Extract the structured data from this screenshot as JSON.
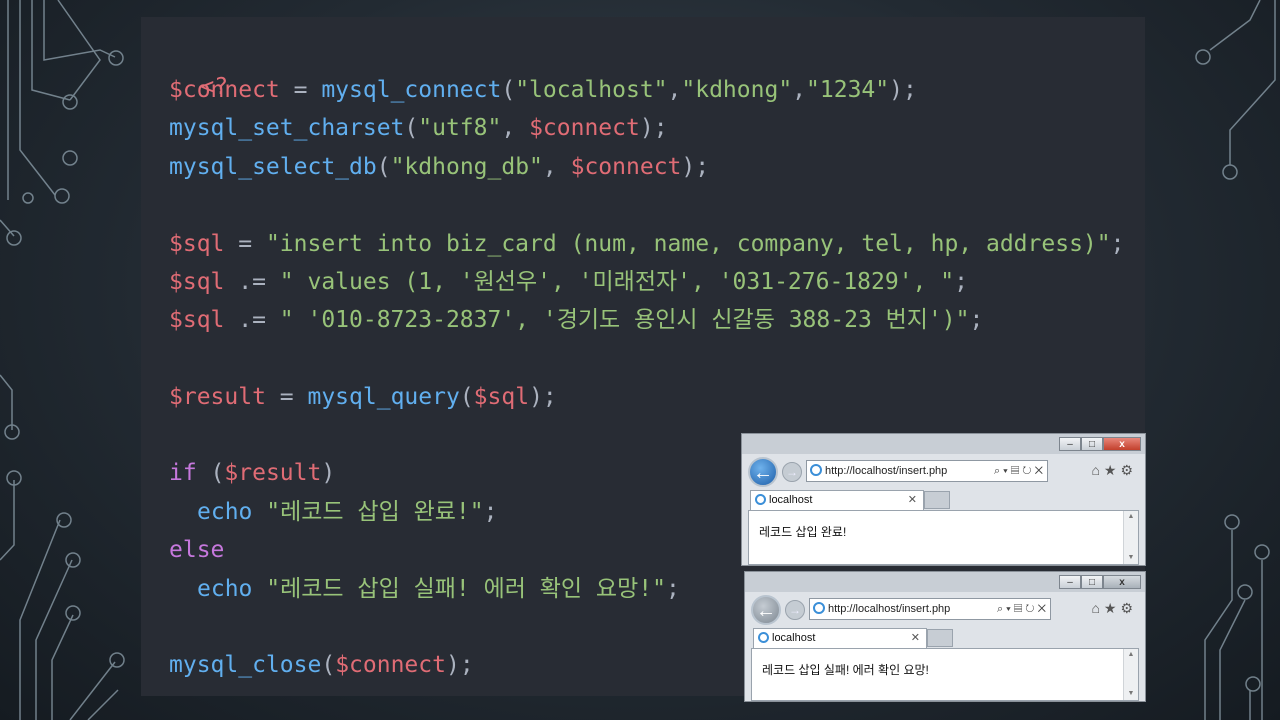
{
  "code": {
    "open_tag": "<?",
    "close_tag": "?>",
    "l1": {
      "var": "$connect",
      "op": " = ",
      "fn": "mysql_connect",
      "p1": "(",
      "s1": "\"localhost\"",
      "c1": ",",
      "s2": "\"kdhong\"",
      "c2": ",",
      "s3": "\"1234\"",
      "end": ");"
    },
    "l2": {
      "fn": "mysql_set_charset",
      "p1": "(",
      "s1": "\"utf8\"",
      "c1": ", ",
      "var": "$connect",
      "end": ");"
    },
    "l3": {
      "fn": "mysql_select_db",
      "p1": "(",
      "s1": "\"kdhong_db\"",
      "c1": ", ",
      "var": "$connect",
      "end": ");"
    },
    "l4": {
      "var": "$sql",
      "op": " = ",
      "str": "\"insert into biz_card (num, name, company, tel, hp, address)\"",
      "end": ";"
    },
    "l5": {
      "var": "$sql",
      "op": " .= ",
      "str": "\" values (1, '원선우', '미래전자', '031-276-1829', \"",
      "end": ";"
    },
    "l6": {
      "var": "$sql",
      "op": " .= ",
      "str": "\" '010-8723-2837', '경기도 용인시 신갈동 388-23 번지')\"",
      "end": ";"
    },
    "l7": {
      "var": "$result",
      "op": " = ",
      "fn": "mysql_query",
      "p1": "(",
      "arg": "$sql",
      "end": ");"
    },
    "l8": {
      "kw": "if",
      "p1": " (",
      "var": "$result",
      "end": ")"
    },
    "l9": {
      "fn": "echo",
      "str": " \"레코드 삽입 완료!\"",
      "end": ";"
    },
    "l10": {
      "kw": "else"
    },
    "l11": {
      "fn": "echo",
      "str": " \"레코드 삽입 실패! 에러 확인 요망!\"",
      "end": ";"
    },
    "l12": {
      "fn": "mysql_close",
      "p1": "(",
      "var": "$connect",
      "end": ");"
    }
  },
  "browser_success": {
    "url": "http://localhost/insert.php",
    "tab_label": "localhost",
    "message": "레코드 삽입 완료!"
  },
  "browser_failure": {
    "url": "http://localhost/insert.php",
    "tab_label": "localhost",
    "message": "레코드 삽입 실패! 에러 확인 요망!"
  },
  "icons": {
    "back": "arrow-left-icon",
    "forward": "arrow-right-icon",
    "tools": "home-star-gear-icons"
  },
  "colors": {
    "editor_bg": "#282c34",
    "variable": "#e06c75",
    "function": "#61afef",
    "string": "#98c379",
    "keyword": "#c678dd"
  }
}
